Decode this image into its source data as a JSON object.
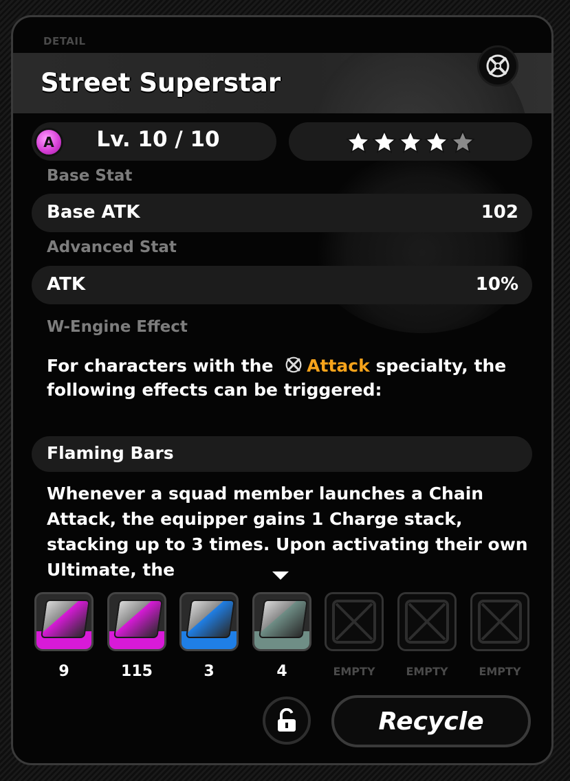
{
  "header": {
    "section": "DETAIL",
    "title": "Street Superstar"
  },
  "level": {
    "rank": "A",
    "text": "Lv. 10 / 10",
    "stars_filled": 4,
    "stars_total": 5
  },
  "base_stat": {
    "label": "Base Stat",
    "name": "Base ATK",
    "value": "102"
  },
  "advanced_stat": {
    "label": "Advanced Stat",
    "name": "ATK",
    "value": "10%"
  },
  "effect": {
    "label": "W-Engine Effect",
    "intro_before": "For characters with the",
    "specialty": "Attack",
    "intro_after": "specialty, the following effects can be triggered:",
    "name": "Flaming Bars",
    "description": "Whenever a squad member launches a Chain Attack, the equipper gains 1 Charge stack, stacking up to 3 times. Upon activating their own Ultimate, the"
  },
  "slots": [
    {
      "count": "9",
      "state": "filled",
      "color": "#d81ad8",
      "icon": "cross-chip-icon"
    },
    {
      "count": "115",
      "state": "filled",
      "color": "#d81ad8",
      "icon": "pink-chip-icon"
    },
    {
      "count": "3",
      "state": "filled",
      "color": "#1f7fe6",
      "icon": "blue-chip-icon"
    },
    {
      "count": "4",
      "state": "filled",
      "color": "#6f8e86",
      "icon": "grey-chip-icon"
    },
    {
      "count": "EMPTY",
      "state": "empty"
    },
    {
      "count": "EMPTY",
      "state": "empty"
    },
    {
      "count": "EMPTY",
      "state": "empty"
    }
  ],
  "actions": {
    "recycle": "Recycle"
  },
  "colors": {
    "accent": "#f6a31b",
    "rank": "#d33bd3"
  }
}
